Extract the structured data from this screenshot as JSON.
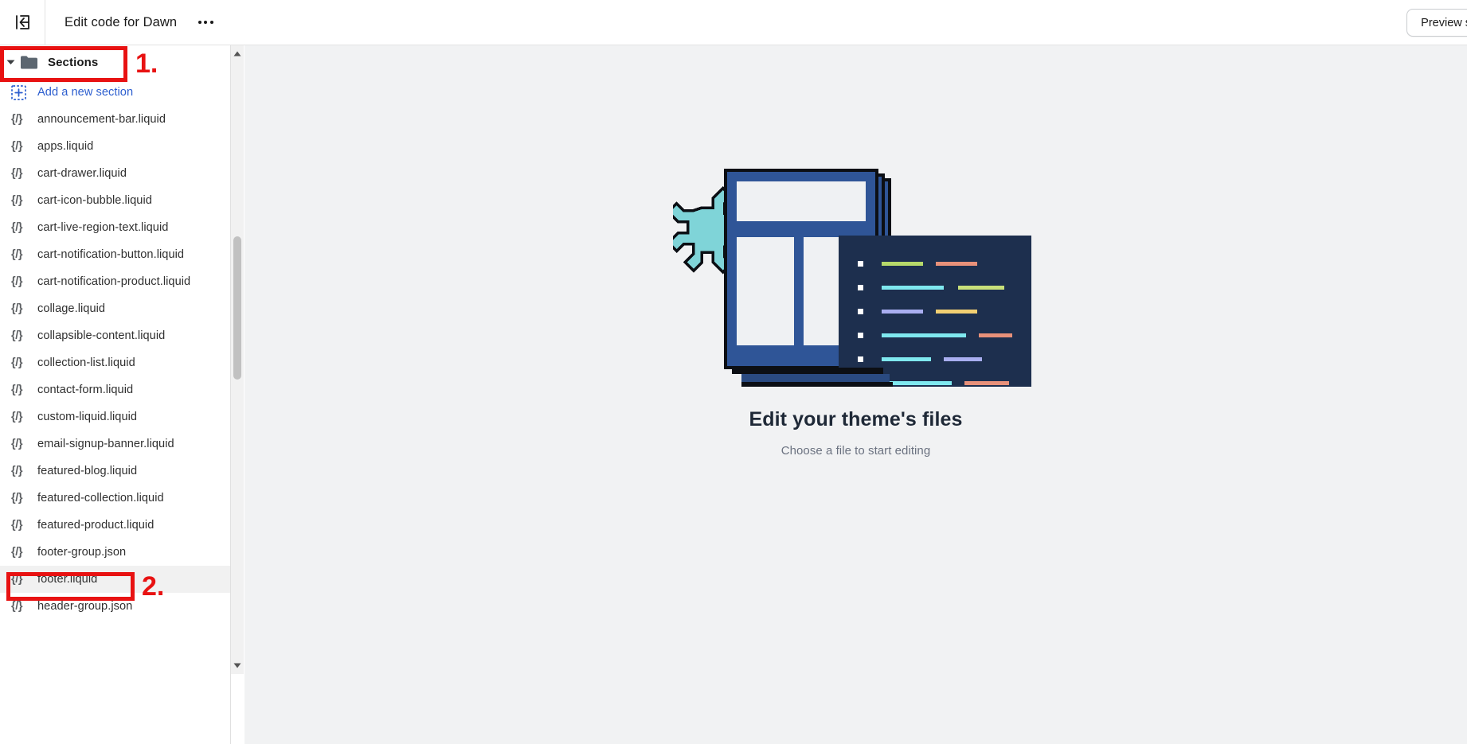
{
  "topbar": {
    "back_icon": "exit-arrow-icon",
    "title": "Edit code for Dawn",
    "more_label": "More actions",
    "preview_label": "Preview store"
  },
  "sidebar": {
    "group": {
      "label": "Sections",
      "icon": "folder-icon",
      "expanded": true
    },
    "add_action": {
      "label": "Add a new section",
      "icon": "add-square-icon",
      "color": "#2c5ecf"
    },
    "file_icon_glyph": "{/}",
    "files": [
      {
        "name": "announcement-bar.liquid",
        "selected": false
      },
      {
        "name": "apps.liquid",
        "selected": false
      },
      {
        "name": "cart-drawer.liquid",
        "selected": false
      },
      {
        "name": "cart-icon-bubble.liquid",
        "selected": false
      },
      {
        "name": "cart-live-region-text.liquid",
        "selected": false
      },
      {
        "name": "cart-notification-button.liquid",
        "selected": false
      },
      {
        "name": "cart-notification-product.liquid",
        "selected": false
      },
      {
        "name": "collage.liquid",
        "selected": false
      },
      {
        "name": "collapsible-content.liquid",
        "selected": false
      },
      {
        "name": "collection-list.liquid",
        "selected": false
      },
      {
        "name": "contact-form.liquid",
        "selected": false
      },
      {
        "name": "custom-liquid.liquid",
        "selected": false
      },
      {
        "name": "email-signup-banner.liquid",
        "selected": false
      },
      {
        "name": "featured-blog.liquid",
        "selected": false
      },
      {
        "name": "featured-collection.liquid",
        "selected": false
      },
      {
        "name": "featured-product.liquid",
        "selected": false
      },
      {
        "name": "footer-group.json",
        "selected": false
      },
      {
        "name": "footer.liquid",
        "selected": true
      },
      {
        "name": "header-group.json",
        "selected": false
      }
    ],
    "scrollbar": {
      "up_icon": "scroll-up-arrow-icon",
      "down_icon": "scroll-down-arrow-icon"
    }
  },
  "main": {
    "empty_state": {
      "title": "Edit your theme's files",
      "subtitle": "Choose a file to start editing",
      "illustration_name": "theme-files-illustration"
    }
  },
  "annotations": [
    {
      "id": "1",
      "label": "1.",
      "target": "sections-folder-row"
    },
    {
      "id": "2",
      "label": "2.",
      "target": "footer-liquid-row"
    }
  ],
  "colors": {
    "accent_link": "#2c5ecf",
    "annotation_red": "#e81212",
    "panel_bg": "#f1f2f3",
    "selected_row": "#f1f1f1",
    "illustration_blue": "#2f5597",
    "illustration_dark": "#1d2f4e",
    "illustration_teal": "#7fd4d8",
    "code_green": "#b6d96a",
    "code_cyan": "#7fe8ef",
    "code_purple": "#a9aef0",
    "code_orange": "#e8917a",
    "code_yellow": "#f2cf72"
  }
}
